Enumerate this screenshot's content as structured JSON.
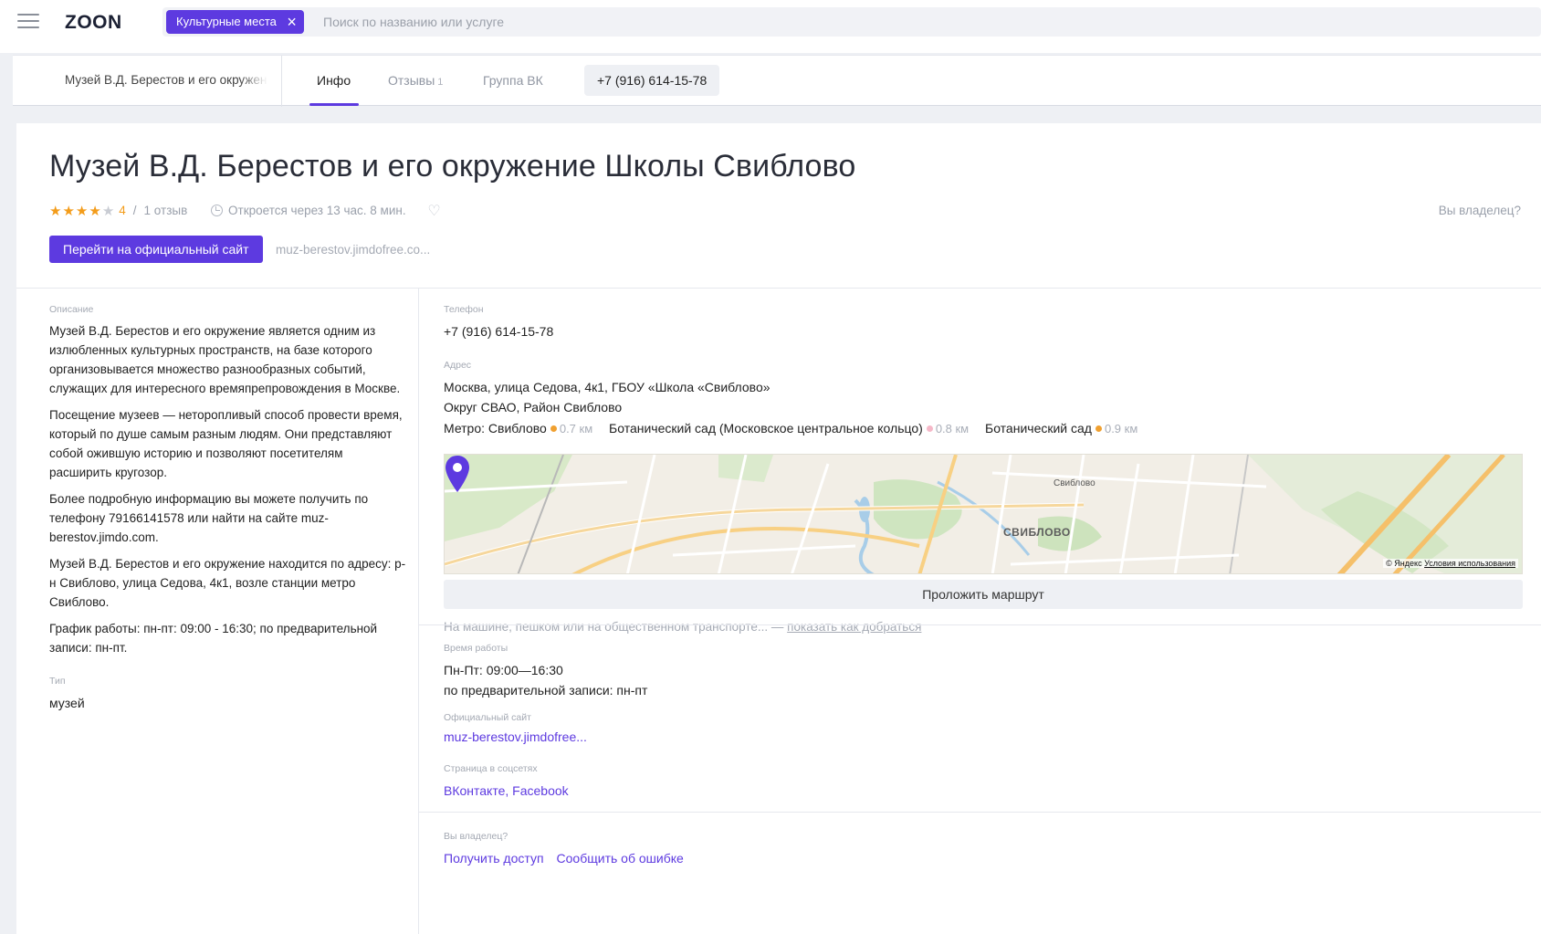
{
  "header": {
    "logo": "ZOON",
    "chip_label": "Культурные места",
    "search_placeholder": "Поиск по названию или услуге"
  },
  "tabs": {
    "venue_title": "Музей В.Д. Берестов и его окружение Школы Свиблово",
    "info": "Инфо",
    "reviews": "Отзывы",
    "reviews_count": "1",
    "vk_group": "Группа ВК",
    "phone": "+7 (916) 614-15-78"
  },
  "venue": {
    "title": "Музей В.Д. Берестов и его окружение Школы Свиблово",
    "rating": "4",
    "rating_value": 4,
    "rating_max": 5,
    "slash": "/",
    "reviews_text": "1 отзыв",
    "opens_text": "Откроется через 13 час. 8 мин.",
    "owner_question": "Вы владелец?",
    "site_button": "Перейти на официальный сайт",
    "site_url": "muz-berestov.jimdofree.co..."
  },
  "description": {
    "label": "Описание",
    "paragraphs": [
      "Музей В.Д. Берестов и его окружение является одним из излюбленных культурных пространств, на базе которого организовывается множество разнообразных событий, служащих для интересного времяпрепровождения в Москве.",
      "Посещение музеев — неторопливый способ провести время, который по душе самым разным людям. Они представляют собой ожившую историю и позволяют посетителям расширить кругозор.",
      "Более подробную информацию вы можете получить по телефону 79166141578 или найти на сайте muz-berestov.jimdo.com.",
      "Музей В.Д. Берестов и его окружение находится по адресу: р-н Свиблово, улица Седова, 4к1, возле станции метро Свиблово.",
      "График работы: пн-пт: 09:00 - 16:30; по предварительной записи: пн-пт."
    ],
    "type_label": "Тип",
    "type_value": "музей"
  },
  "contacts": {
    "phone_label": "Телефон",
    "phone": "+7 (916) 614-15-78",
    "address_label": "Адрес",
    "address_line1": "Москва, улица Седова, 4к1, ГБОУ «Школа «Свиблово»",
    "address_line2": "Округ СВАО, Район Свиблово",
    "metro_prefix": "Метро:",
    "metro": [
      {
        "name": "Свиблово",
        "distance": "0.7 км",
        "color": "#f0a030"
      },
      {
        "name": "Ботанический сад (Московское центральное кольцо)",
        "distance": "0.8 км",
        "color": "#f5b8c8"
      },
      {
        "name": "Ботанический сад",
        "distance": "0.9 км",
        "color": "#f0a030"
      }
    ]
  },
  "map": {
    "district": "СВИБЛОВО",
    "station": "Свиблово",
    "copyright": "© Яндекс",
    "terms": "Условия использования"
  },
  "route": {
    "button": "Проложить маршрут",
    "hint": "На машине, пешком или на общественном транспорте... —",
    "hint_link": "показать как добраться"
  },
  "hours": {
    "label": "Время работы",
    "line1": "Пн-Пт: 09:00—16:30",
    "line2": "по предварительной записи: пн-пт"
  },
  "website": {
    "label": "Официальный сайт",
    "value": "muz-berestov.jimdofree..."
  },
  "social": {
    "label": "Страница в соцсетях",
    "vk": "ВКонтакте",
    "separator": ",",
    "fb": "Facebook"
  },
  "owner": {
    "label": "Вы владелец?",
    "get_access": "Получить доступ",
    "report_error": "Сообщить об ошибке"
  },
  "colors": {
    "accent": "#5d3ae0",
    "star": "#f39c1a"
  }
}
